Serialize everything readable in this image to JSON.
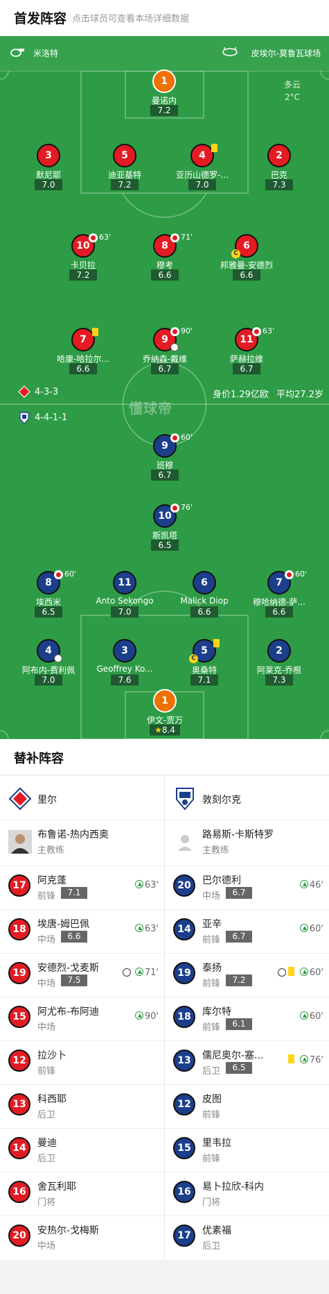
{
  "header": {
    "title": "首发阵容",
    "subtitle": "点击球员可查看本场详细数据"
  },
  "match": {
    "whistle_icon": "whistle-icon",
    "home_team": "米洛特",
    "stadium_icon": "stadium-icon",
    "stadium": "皮埃尔-莫鲁瓦球场",
    "weather": "多云",
    "temp": "2°C"
  },
  "home_lineup": {
    "formation": "4-3-3",
    "value": "身价1.29亿欧",
    "age": "平均27.2岁",
    "crest_icon": "lille-crest-icon",
    "players": [
      {
        "num": "1",
        "name": "曼诺内",
        "rating": "7.2",
        "kit": "orange"
      },
      {
        "num": "3",
        "name": "默尼耶",
        "rating": "7.0",
        "kit": "red"
      },
      {
        "num": "5",
        "name": "迪亚基特",
        "rating": "7.2",
        "kit": "red"
      },
      {
        "num": "4",
        "name": "亚历山德罗-...",
        "rating": "7.0",
        "kit": "red",
        "yellow": true
      },
      {
        "num": "2",
        "name": "巴克",
        "rating": "7.3",
        "kit": "red"
      },
      {
        "num": "10",
        "name": "卡贝拉",
        "rating": "7.2",
        "kit": "red",
        "sub": "63'"
      },
      {
        "num": "8",
        "name": "穆考",
        "rating": "6.6",
        "kit": "red",
        "sub": "71'"
      },
      {
        "num": "6",
        "name": "邦雅曼-安德烈",
        "rating": "6.6",
        "kit": "red",
        "captain": "C"
      },
      {
        "num": "7",
        "name": "哈康-哈拉尔...",
        "rating": "6.6",
        "kit": "red",
        "yellow": true
      },
      {
        "num": "9",
        "name": "乔纳森-戴维",
        "rating": "6.7",
        "kit": "red",
        "sub": "90'",
        "goal": true
      },
      {
        "num": "11",
        "name": "萨赫拉维",
        "rating": "6.7",
        "kit": "red",
        "sub": "63'"
      }
    ]
  },
  "away_lineup": {
    "formation": "4-4-1-1",
    "crest_icon": "dunkerque-crest-icon",
    "players": [
      {
        "num": "9",
        "name": "班穆",
        "rating": "6.7",
        "kit": "blue",
        "sub": "60'"
      },
      {
        "num": "10",
        "name": "斯凯塔",
        "rating": "6.5",
        "kit": "blue",
        "sub": "76'"
      },
      {
        "num": "8",
        "name": "埃西米",
        "rating": "6.5",
        "kit": "blue",
        "sub": "60'",
        "goal": true
      },
      {
        "num": "11",
        "name": "Anto Sekongo",
        "rating": "7.0",
        "kit": "blue"
      },
      {
        "num": "6",
        "name": "Malick Diop",
        "rating": "6.6",
        "kit": "blue"
      },
      {
        "num": "7",
        "name": "穆哈纳德-萨...",
        "rating": "6.6",
        "kit": "blue",
        "sub": "60'"
      },
      {
        "num": "4",
        "name": "阿布内-费利佩",
        "rating": "7.0",
        "kit": "blue",
        "goal": true
      },
      {
        "num": "3",
        "name": "Geoffrey Ko...",
        "rating": "7.6",
        "kit": "blue"
      },
      {
        "num": "5",
        "name": "奥桑特",
        "rating": "7.1",
        "kit": "blue",
        "yellow": true,
        "captain": "C"
      },
      {
        "num": "2",
        "name": "阿莱克-乔根",
        "rating": "7.3",
        "kit": "blue"
      },
      {
        "num": "1",
        "name": "伊文-贾万",
        "rating": "8.4",
        "kit": "orange",
        "star": "★"
      }
    ]
  },
  "watermark": "懂球帝",
  "subs": {
    "title": "替补阵容",
    "home": {
      "team": "里尔",
      "coach_name": "布鲁诺-热内西奥",
      "coach_role": "主教练",
      "players": [
        {
          "num": "17",
          "name": "阿克蓬",
          "pos": "前锋",
          "rating": "7.1",
          "sub": "63'"
        },
        {
          "num": "18",
          "name": "埃唐-姆巴佩",
          "pos": "中场",
          "rating": "6.6",
          "sub": "63'"
        },
        {
          "num": "19",
          "name": "安德烈-戈麦斯",
          "pos": "中场",
          "rating": "7.5",
          "sub": "71'",
          "goal": true
        },
        {
          "num": "15",
          "name": "阿尤布-布阿迪",
          "pos": "中场",
          "sub": "90'"
        },
        {
          "num": "12",
          "name": "拉沙卜",
          "pos": "前锋"
        },
        {
          "num": "13",
          "name": "科西耶",
          "pos": "后卫"
        },
        {
          "num": "14",
          "name": "曼迪",
          "pos": "后卫"
        },
        {
          "num": "16",
          "name": "舍瓦利耶",
          "pos": "门将"
        },
        {
          "num": "20",
          "name": "安热尔-戈梅斯",
          "pos": "中场"
        }
      ]
    },
    "away": {
      "team": "敦刻尔克",
      "coach_name": "路易斯-卡斯特罗",
      "coach_role": "主教练",
      "players": [
        {
          "num": "20",
          "name": "巴尔德利",
          "pos": "中场",
          "rating": "6.7",
          "sub": "46'"
        },
        {
          "num": "14",
          "name": "亚辛",
          "pos": "前锋",
          "rating": "6.7",
          "sub": "60'"
        },
        {
          "num": "19",
          "name": "泰扬",
          "pos": "前锋",
          "rating": "7.2",
          "sub": "60'",
          "goal": true,
          "yellow": true
        },
        {
          "num": "18",
          "name": "库尔特",
          "pos": "前锋",
          "rating": "6.1",
          "sub": "60'"
        },
        {
          "num": "13",
          "name": "儒尼奥尔-塞...",
          "pos": "后卫",
          "rating": "6.5",
          "sub": "76'",
          "yellow": true
        },
        {
          "num": "12",
          "name": "皮图",
          "pos": "前锋"
        },
        {
          "num": "15",
          "name": "里韦拉",
          "pos": "前锋"
        },
        {
          "num": "16",
          "name": "易卜拉欣-科内",
          "pos": "门将"
        },
        {
          "num": "17",
          "name": "优素福",
          "pos": "后卫"
        }
      ]
    }
  },
  "colors": {
    "pitch": "#2e9c46",
    "home_kit": "#e31b23",
    "away_kit": "#1c3f8c",
    "gk_kit": "#f07000",
    "yellow": "#ffd31a"
  }
}
